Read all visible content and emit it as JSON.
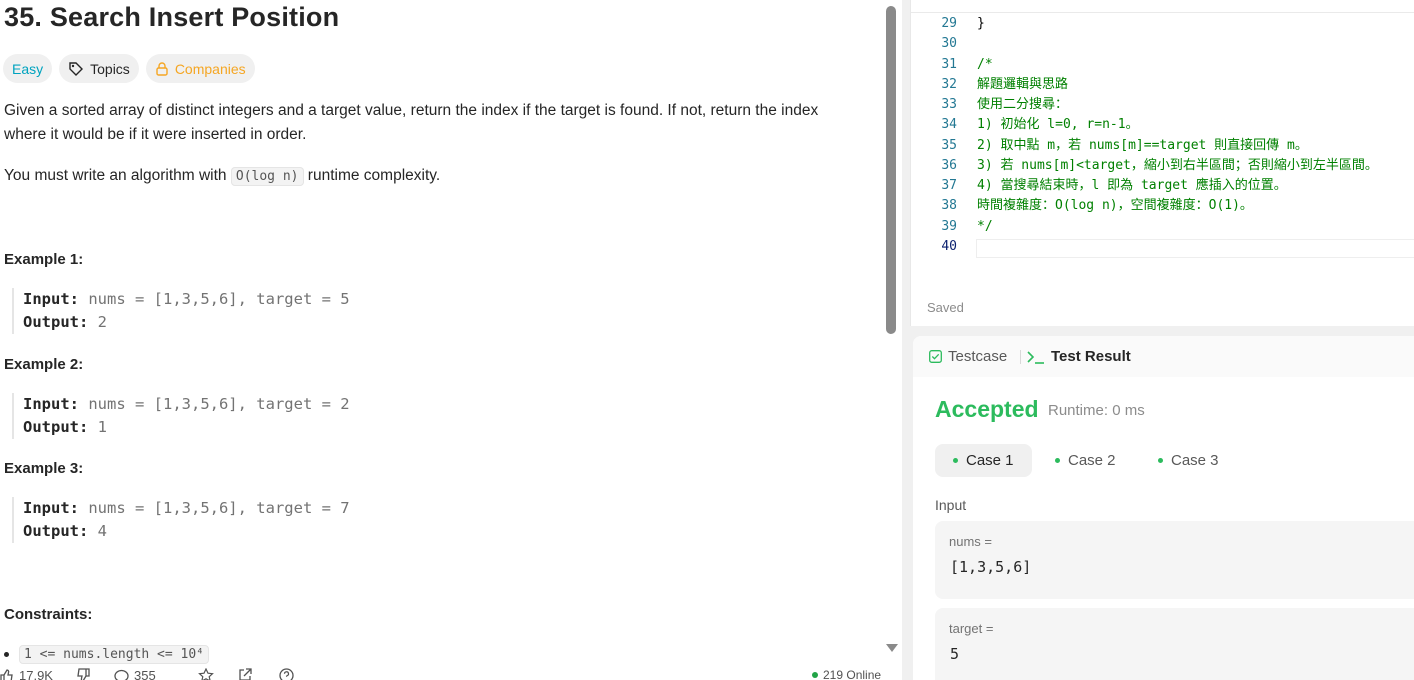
{
  "problem": {
    "title": "35. Search Insert Position",
    "tags": {
      "difficulty": "Easy",
      "topics": "Topics",
      "companies": "Companies"
    },
    "description_1": "Given a sorted array of distinct integers and a target value, return the index if the target is found. If not, return the index where it would be if it were inserted in order.",
    "description_2_before": "You must write an algorithm with ",
    "description_2_code": "O(log n)",
    "description_2_after": " runtime complexity.",
    "examples": [
      {
        "heading": "Example 1:",
        "input_label": "Input:",
        "input": " nums = [1,3,5,6], target = 5",
        "output_label": "Output:",
        "output": " 2"
      },
      {
        "heading": "Example 2:",
        "input_label": "Input:",
        "input": " nums = [1,3,5,6], target = 2",
        "output_label": "Output:",
        "output": " 1"
      },
      {
        "heading": "Example 3:",
        "input_label": "Input:",
        "input": " nums = [1,3,5,6], target = 7",
        "output_label": "Output:",
        "output": " 4"
      }
    ],
    "constraints_heading": "Constraints:",
    "constraint_1": "1 <= nums.length <= 10⁴"
  },
  "bottom_bar": {
    "likes": "17.9K",
    "comments": "355",
    "online": "219 Online"
  },
  "editor": {
    "lines": [
      {
        "n": "29",
        "text": "}"
      },
      {
        "n": "30",
        "text": ""
      },
      {
        "n": "31",
        "text": "/*"
      },
      {
        "n": "32",
        "text": "解題邏輯與思路"
      },
      {
        "n": "33",
        "text": "使用二分搜尋："
      },
      {
        "n": "34",
        "text": "1) 初始化 l=0, r=n-1。"
      },
      {
        "n": "35",
        "text": "2) 取中點 m，若 nums[m]==target 則直接回傳 m。"
      },
      {
        "n": "36",
        "text": "3) 若 nums[m]<target，縮小到右半區間；否則縮小到左半區間。"
      },
      {
        "n": "37",
        "text": "4) 當搜尋結束時，l 即為 target 應插入的位置。"
      },
      {
        "n": "38",
        "text": "時間複雜度：O(log n)，空間複雜度：O(1)。"
      },
      {
        "n": "39",
        "text": "*/"
      },
      {
        "n": "40",
        "text": ""
      }
    ],
    "status": "Saved"
  },
  "result": {
    "tab_testcase": "Testcase",
    "tab_result": "Test Result",
    "verdict": "Accepted",
    "runtime": "Runtime: 0 ms",
    "cases": [
      "Case 1",
      "Case 2",
      "Case 3"
    ],
    "input_label": "Input",
    "inputs": [
      {
        "name": "nums =",
        "value": "[1,3,5,6]"
      },
      {
        "name": "target =",
        "value": "5"
      }
    ]
  },
  "colors": {
    "accent_green": "#2cbb5d",
    "easy_teal": "#00a3bf",
    "companies_orange": "#f5a623",
    "comment_green": "#008000"
  }
}
